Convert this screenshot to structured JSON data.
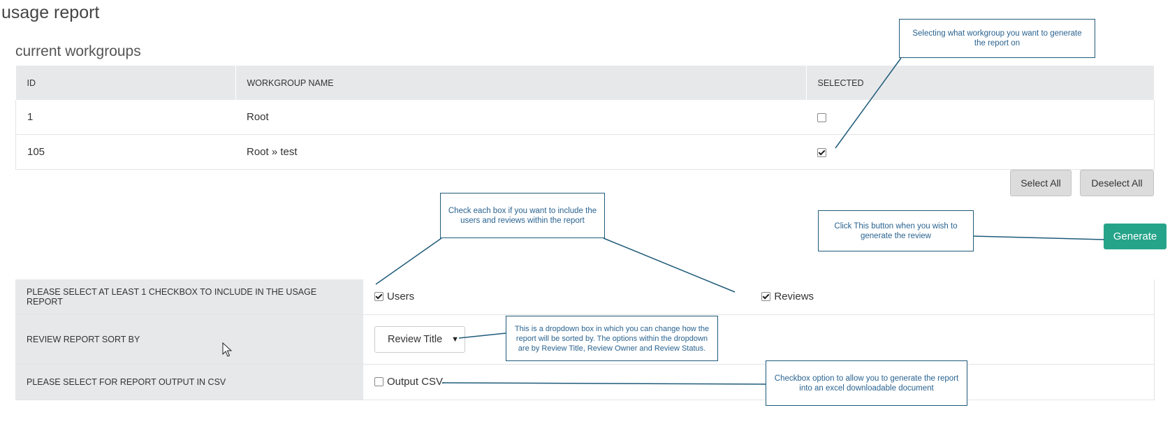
{
  "page": {
    "title": "usage report"
  },
  "workgroups": {
    "section_title": "current workgroups",
    "columns": [
      "ID",
      "WORKGROUP NAME",
      "SELECTED"
    ],
    "rows": [
      {
        "id": "1",
        "name": "Root",
        "selected": false
      },
      {
        "id": "105",
        "name": "Root » test",
        "selected": true
      }
    ],
    "select_all_label": "Select All",
    "deselect_all_label": "Deselect All"
  },
  "generate_label": "Generate",
  "options": {
    "include_label": "PLEASE SELECT AT LEAST 1 CHECKBOX TO INCLUDE IN THE USAGE REPORT",
    "users_label": "Users",
    "users_checked": true,
    "reviews_label": "Reviews",
    "reviews_checked": true,
    "sort_label": "REVIEW REPORT SORT BY",
    "sort_value": "Review Title",
    "csv_label": "PLEASE SELECT FOR REPORT OUTPUT IN CSV",
    "csv_option_label": "Output CSV",
    "csv_checked": false
  },
  "callouts": {
    "workgroup": "Selecting what workgroup you want to generate the report on",
    "checkboxes": "Check each box if you want to include the users and reviews within the report",
    "generate": "Click This button when you wish to generate the review",
    "dropdown": "This is a dropdown box in which you can change how the report will be sorted by. The options within the dropdown are by Review Title, Review Owner and Review Status.",
    "csv": "Checkbox option to allow you to generate the report into an excel downloadable document"
  },
  "colors": {
    "accent": "#26a48a",
    "callout_border": "#1f5b7a",
    "callout_text": "#2a6390",
    "header_bg": "#e6e8ea"
  }
}
